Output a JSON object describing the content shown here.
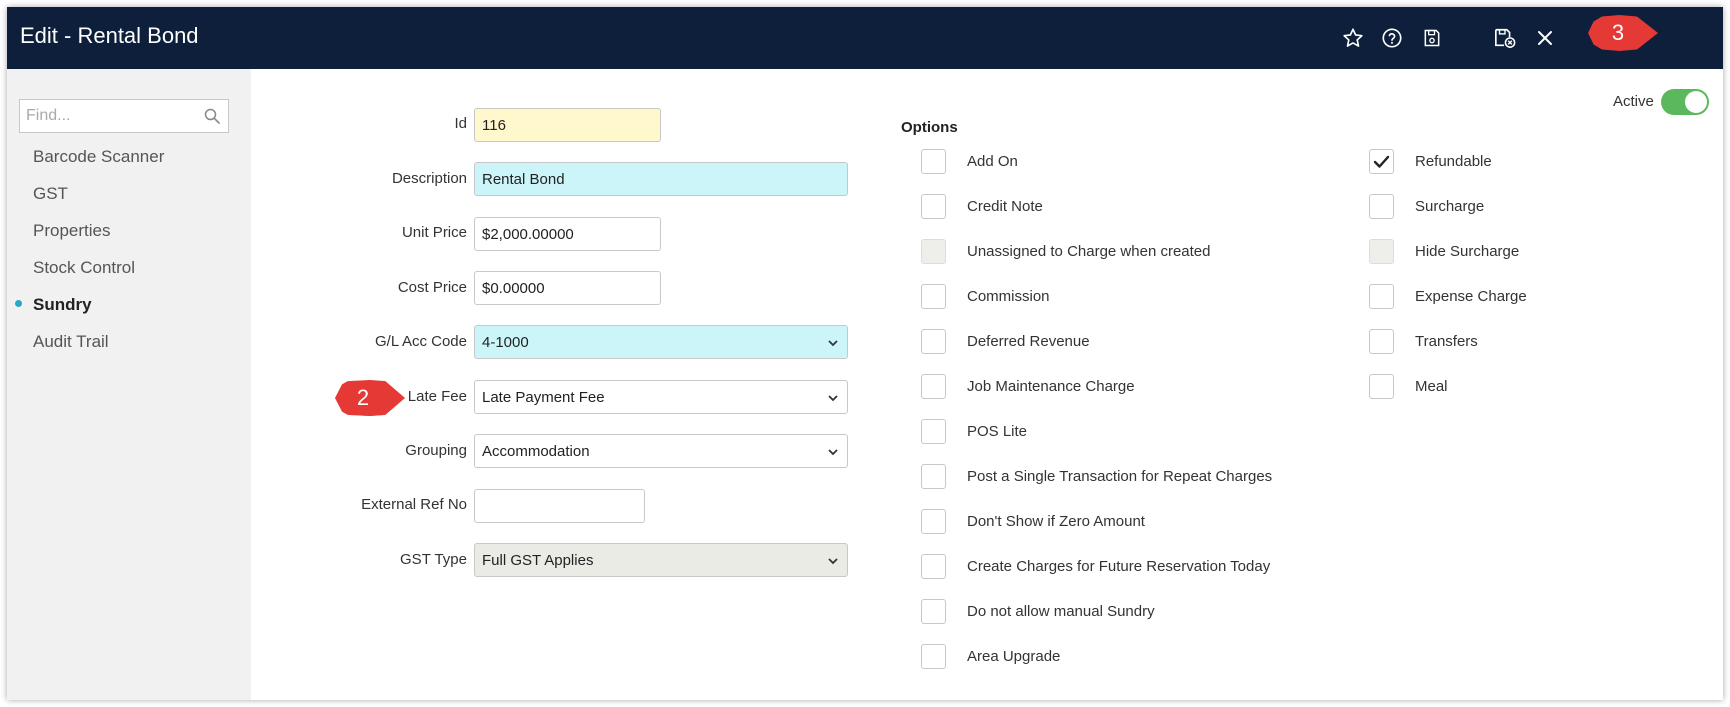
{
  "window": {
    "title": "Edit - Rental Bond"
  },
  "titlebar": {
    "icons": [
      "star-icon",
      "help-icon",
      "save-icon",
      "save-and-close-icon",
      "close-icon"
    ]
  },
  "annotations": {
    "marker_2": "2",
    "marker_3": "3",
    "marker_color": "#e53935"
  },
  "sidebar": {
    "search_placeholder": "Find...",
    "items": [
      {
        "label": "Barcode Scanner"
      },
      {
        "label": "GST"
      },
      {
        "label": "Properties"
      },
      {
        "label": "Stock Control"
      },
      {
        "label": "Sundry",
        "active": true
      },
      {
        "label": "Audit Trail"
      }
    ],
    "active_dot_color": "#26a9c9"
  },
  "form": {
    "id": {
      "label": "Id",
      "value": "116"
    },
    "description": {
      "label": "Description",
      "value": "Rental Bond"
    },
    "unit_price": {
      "label": "Unit Price",
      "value": "$2,000.00000"
    },
    "cost_price": {
      "label": "Cost Price",
      "value": "$0.00000"
    },
    "gl_acc_code": {
      "label": "G/L Acc Code",
      "value": "4-1000"
    },
    "late_fee": {
      "label": "Late Fee",
      "value": "Late Payment Fee"
    },
    "grouping": {
      "label": "Grouping",
      "value": "Accommodation"
    },
    "external_ref": {
      "label": "External Ref No",
      "value": ""
    },
    "gst_type": {
      "label": "GST Type",
      "value": "Full GST Applies"
    }
  },
  "status": {
    "active_label": "Active",
    "active": true
  },
  "options": {
    "title": "Options",
    "left": [
      {
        "label": "Add On",
        "checked": false,
        "disabled": false
      },
      {
        "label": "Credit Note",
        "checked": false,
        "disabled": false
      },
      {
        "label": "Unassigned to Charge when created",
        "checked": false,
        "disabled": true
      },
      {
        "label": "Commission",
        "checked": false,
        "disabled": false
      },
      {
        "label": "Deferred Revenue",
        "checked": false,
        "disabled": false
      },
      {
        "label": "Job Maintenance Charge",
        "checked": false,
        "disabled": false
      },
      {
        "label": "POS Lite",
        "checked": false,
        "disabled": false
      },
      {
        "label": "Post a Single Transaction for Repeat Charges",
        "checked": false,
        "disabled": false
      },
      {
        "label": "Don't Show if Zero Amount",
        "checked": false,
        "disabled": false
      },
      {
        "label": "Create Charges for Future Reservation Today",
        "checked": false,
        "disabled": false
      },
      {
        "label": "Do not allow manual Sundry",
        "checked": false,
        "disabled": false
      },
      {
        "label": "Area Upgrade",
        "checked": false,
        "disabled": false
      }
    ],
    "right": [
      {
        "label": "Refundable",
        "checked": true,
        "disabled": false
      },
      {
        "label": "Surcharge",
        "checked": false,
        "disabled": false
      },
      {
        "label": "Hide Surcharge",
        "checked": false,
        "disabled": true
      },
      {
        "label": "Expense Charge",
        "checked": false,
        "disabled": false
      },
      {
        "label": "Transfers",
        "checked": false,
        "disabled": false
      },
      {
        "label": "Meal",
        "checked": false,
        "disabled": false
      }
    ]
  },
  "colors": {
    "titlebar": "#0d1f3b",
    "id_field": "#fff8cc",
    "highlight_field": "#ccf5fa",
    "toggle_on": "#5cb85c"
  }
}
